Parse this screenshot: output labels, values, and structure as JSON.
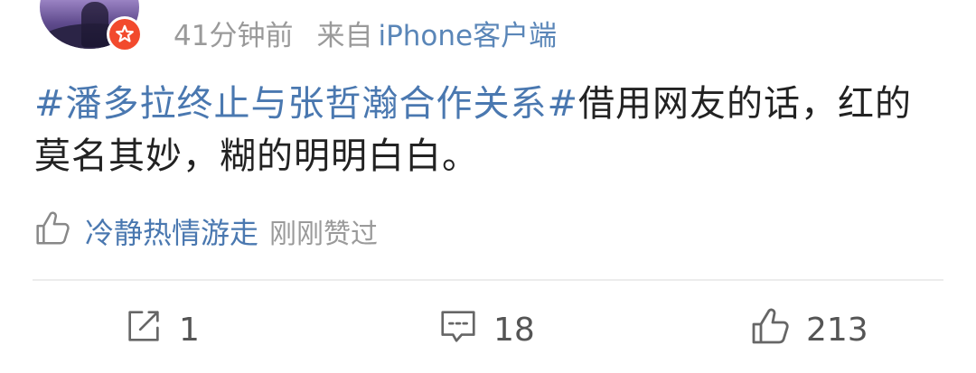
{
  "post": {
    "time": "41分钟前",
    "from_prefix": "来自",
    "client": "iPhone客户端",
    "topic": "#潘多拉终止与张哲瀚合作关系#",
    "body_text": "借用网友的话，红的莫名其妙，糊的明明白白。"
  },
  "likes": {
    "liker_name": "冷静热情游走",
    "liker_status": "刚刚赞过"
  },
  "actions": {
    "repost_count": "1",
    "comment_count": "18",
    "like_count": "213"
  },
  "colors": {
    "link_blue": "#4a78b0",
    "meta_gray": "#9a9a9a",
    "badge_red": "#f24a2d"
  },
  "icons": {
    "verified": "verified-badge-icon",
    "like_small": "thumbs-up-icon",
    "repost": "repost-icon",
    "comment": "comment-icon",
    "like": "thumbs-up-icon"
  }
}
